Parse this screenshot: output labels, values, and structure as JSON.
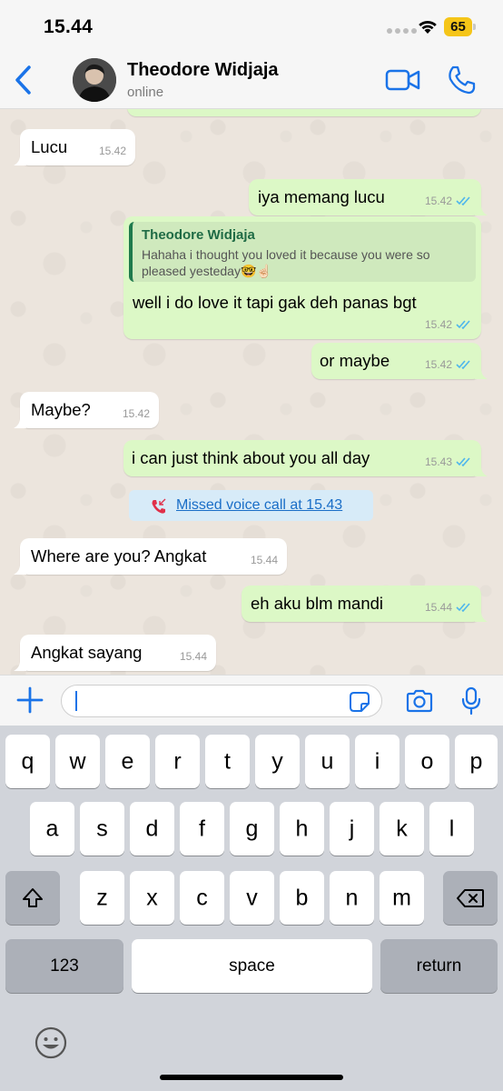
{
  "status_bar": {
    "time": "15.44",
    "battery": "65"
  },
  "header": {
    "contact_name": "Theodore Widjaja",
    "status": "online"
  },
  "messages": [
    {
      "dir": "in",
      "text": "Lucu",
      "time": "15.42"
    },
    {
      "dir": "out",
      "text": "iya memang lucu",
      "time": "15.42"
    },
    {
      "dir": "out",
      "quote_name": "Theodore Widjaja",
      "quote_text": "Hahaha i thought you loved it because you were so pleased yesteday🤓☝🏻",
      "text": "well i do love it tapi gak deh panas bgt",
      "time": "15.42"
    },
    {
      "dir": "out",
      "text": "or maybe",
      "time": "15.42"
    },
    {
      "dir": "in",
      "text": "Maybe?",
      "time": "15.42"
    },
    {
      "dir": "out",
      "text": "i can just think about you all day",
      "time": "15.43"
    },
    {
      "dir": "system",
      "text": "Missed voice call at 15.43"
    },
    {
      "dir": "in",
      "text": "Where are you? Angkat",
      "time": "15.44"
    },
    {
      "dir": "out",
      "text": "eh aku blm mandi",
      "time": "15.44"
    },
    {
      "dir": "in",
      "text": "Angkat sayang",
      "time": "15.44"
    }
  ],
  "input": {
    "value": ""
  },
  "keyboard": {
    "row1": [
      "q",
      "w",
      "e",
      "r",
      "t",
      "y",
      "u",
      "i",
      "o",
      "p"
    ],
    "row2": [
      "a",
      "s",
      "d",
      "f",
      "g",
      "h",
      "j",
      "k",
      "l"
    ],
    "row3": [
      "z",
      "x",
      "c",
      "v",
      "b",
      "n",
      "m"
    ],
    "numbers_key": "123",
    "space_key": "space",
    "return_key": "return"
  },
  "colors": {
    "accent": "#1a73e8",
    "outgoing_bubble": "#dcf8c6",
    "incoming_bubble": "#ffffff",
    "read_ticks": "#4fb6ec",
    "missed_call": "#e0304a"
  }
}
